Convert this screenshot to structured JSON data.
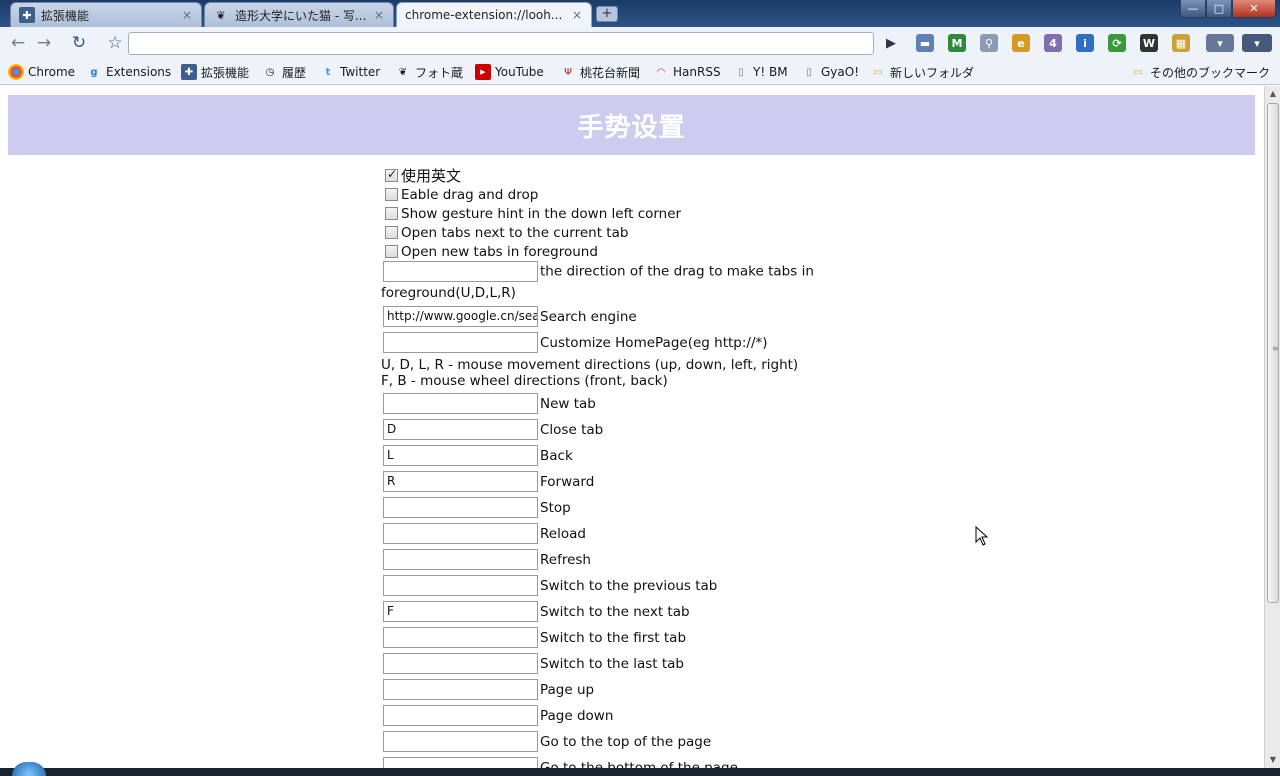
{
  "tabs": [
    {
      "title": "拡張機能",
      "icon": "puzzle-icon",
      "active": false
    },
    {
      "title": "造形大学にいた猫 - 写...",
      "icon": "photo-icon",
      "active": false
    },
    {
      "title": "chrome-extension://looh...",
      "icon": "none",
      "active": true
    }
  ],
  "tab_close_glyph": "×",
  "newtab_glyph": "+",
  "window": {
    "min": "—",
    "max": "□",
    "close": "✕"
  },
  "toolbar": {
    "back": "←",
    "forward": "→",
    "reload": "↻",
    "star": "☆",
    "go": "▶",
    "omnibox_value": ""
  },
  "extensions": [
    {
      "icon": "bars-icon",
      "glyph": "▬",
      "color": "#5f7fb7"
    },
    {
      "icon": "gmail-icon",
      "glyph": "M",
      "color": "#2e8a3a"
    },
    {
      "icon": "magnifier-icon",
      "glyph": "⚲",
      "color": "#8a9bb4"
    },
    {
      "icon": "ie-tab-icon",
      "glyph": "e",
      "color": "#d69a23"
    },
    {
      "icon": "chat-icon",
      "glyph": "4",
      "color": "#7f6fb1"
    },
    {
      "icon": "info-icon",
      "glyph": "i",
      "color": "#2f6fc1"
    },
    {
      "icon": "sync-icon",
      "glyph": "⟳",
      "color": "#3a9a3a"
    },
    {
      "icon": "wikipedia-icon",
      "glyph": "W",
      "color": "#333333"
    },
    {
      "icon": "photo-grid-icon",
      "glyph": "▦",
      "color": "#c9a23c"
    },
    {
      "icon": "page-menu-icon",
      "glyph": "▾",
      "color": "#667799"
    },
    {
      "icon": "wrench-icon",
      "glyph": "▾",
      "color": "#45597a"
    }
  ],
  "bookmarks": [
    {
      "label": "Chrome",
      "icon": "chrome-icon"
    },
    {
      "label": "Extensions",
      "icon": "google-icon"
    },
    {
      "label": "拡張機能",
      "icon": "puzzle-icon"
    },
    {
      "label": "履歴",
      "icon": "clock-icon"
    },
    {
      "label": "Twitter",
      "icon": "twitter-icon"
    },
    {
      "label": "フォト蔵",
      "icon": "photo-icon"
    },
    {
      "label": "YouTube",
      "icon": "youtube-icon"
    },
    {
      "label": "桃花台新聞",
      "icon": "news-icon"
    },
    {
      "label": "HanRSS",
      "icon": "rss-icon"
    },
    {
      "label": "Y! BM",
      "icon": "page-icon"
    },
    {
      "label": "GyaO!",
      "icon": "page-icon"
    },
    {
      "label": "新しいフォルダ",
      "icon": "folder-icon"
    }
  ],
  "other_bookmarks": "その他のブックマーク",
  "page": {
    "title": "手势设置",
    "options": [
      {
        "label": "使用英文",
        "checked": true
      },
      {
        "label": "Eable drag and drop",
        "checked": false
      },
      {
        "label": "Show gesture hint in the down left corner",
        "checked": false
      },
      {
        "label": "Open tabs next to the current tab",
        "checked": false
      },
      {
        "label": "Open new tabs in foreground",
        "checked": false
      }
    ],
    "direction": {
      "value": "",
      "label_part1": "the direction of the drag to make tabs in",
      "label_part2": "foreground(U,D,L,R)"
    },
    "search_engine": {
      "value": "http://www.google.cn/sear",
      "label": "Search engine"
    },
    "homepage": {
      "value": "",
      "label": "Customize HomePage(eg http://*)"
    },
    "help_line1": "U, D, L, R - mouse movement directions (up, down, left, right)",
    "help_line2": "F, B - mouse wheel directions (front, back)",
    "gestures": [
      {
        "value": "",
        "label": "New tab"
      },
      {
        "value": "D",
        "label": "Close tab"
      },
      {
        "value": "L",
        "label": "Back"
      },
      {
        "value": "R",
        "label": "Forward"
      },
      {
        "value": "",
        "label": "Stop"
      },
      {
        "value": "",
        "label": "Reload"
      },
      {
        "value": "",
        "label": "Refresh"
      },
      {
        "value": "",
        "label": "Switch to the previous tab"
      },
      {
        "value": "F",
        "label": "Switch to the next tab"
      },
      {
        "value": "",
        "label": "Switch to the first tab"
      },
      {
        "value": "",
        "label": "Switch to the last tab"
      },
      {
        "value": "",
        "label": "Page up"
      },
      {
        "value": "",
        "label": "Page down"
      },
      {
        "value": "",
        "label": "Go to the top of the page"
      },
      {
        "value": "",
        "label": "Go to the bottom of the page"
      }
    ]
  },
  "scrollbar": {
    "up": "▲",
    "down": "▼",
    "grip": "≡"
  }
}
